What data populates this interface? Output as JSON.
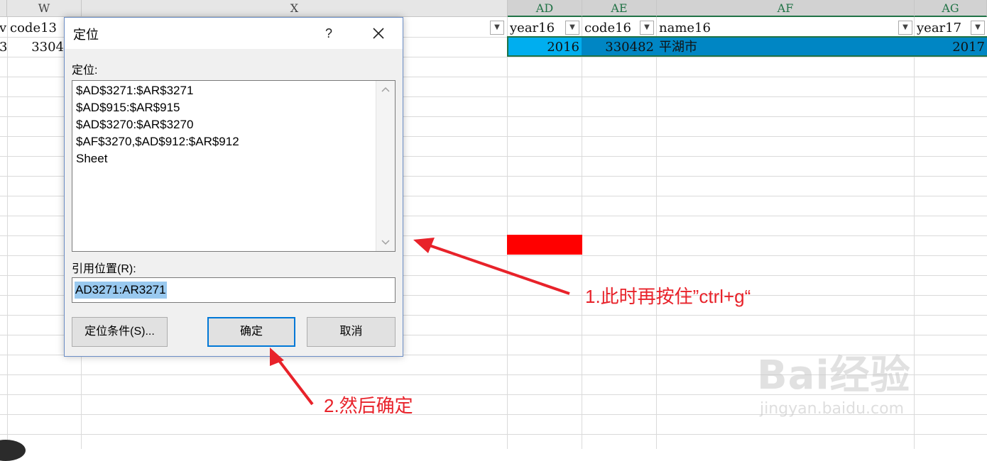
{
  "sheet": {
    "columns": [
      {
        "id": "col-w",
        "label": "W"
      },
      {
        "id": "col-x",
        "label": "X"
      },
      {
        "id": "col-ad",
        "label": "AD"
      },
      {
        "id": "col-ae",
        "label": "AE"
      },
      {
        "id": "col-af",
        "label": "AF"
      },
      {
        "id": "col-ag",
        "label": "AG"
      }
    ],
    "header_row": {
      "v_edge": "v",
      "w": "code13",
      "ad": "year16",
      "ae": "code16",
      "af": "name16",
      "ag": "year17"
    },
    "data_row": {
      "v_edge": "3",
      "w": "3304",
      "ad": "2016",
      "ae": "330482",
      "af": "平湖市",
      "ag": "2017"
    }
  },
  "dialog": {
    "title": "定位",
    "help": "?",
    "goto_label": "定位:",
    "list_items": [
      "$AD$3271:$AR$3271",
      "$AD$915:$AR$915",
      "$AD$3270:$AR$3270",
      "$AF$3270,$AD$912:$AR$912",
      "Sheet"
    ],
    "reference_label": "引用位置(R):",
    "reference_value": "AD3271:AR3271",
    "special_button": "定位条件(S)...",
    "ok_button": "确定",
    "cancel_button": "取消"
  },
  "annotations": {
    "step1": "1.此时再按住”ctrl+g“",
    "step2": "2.然后确定"
  },
  "watermark": {
    "logo": "Bai经验",
    "url": "jingyan.baidu.com"
  },
  "colors": {
    "accent": "#0078d7",
    "annotation": "#e8222a",
    "selected_row": "#0086c4",
    "excel_green": "#217346",
    "marker": "#ff0000"
  }
}
